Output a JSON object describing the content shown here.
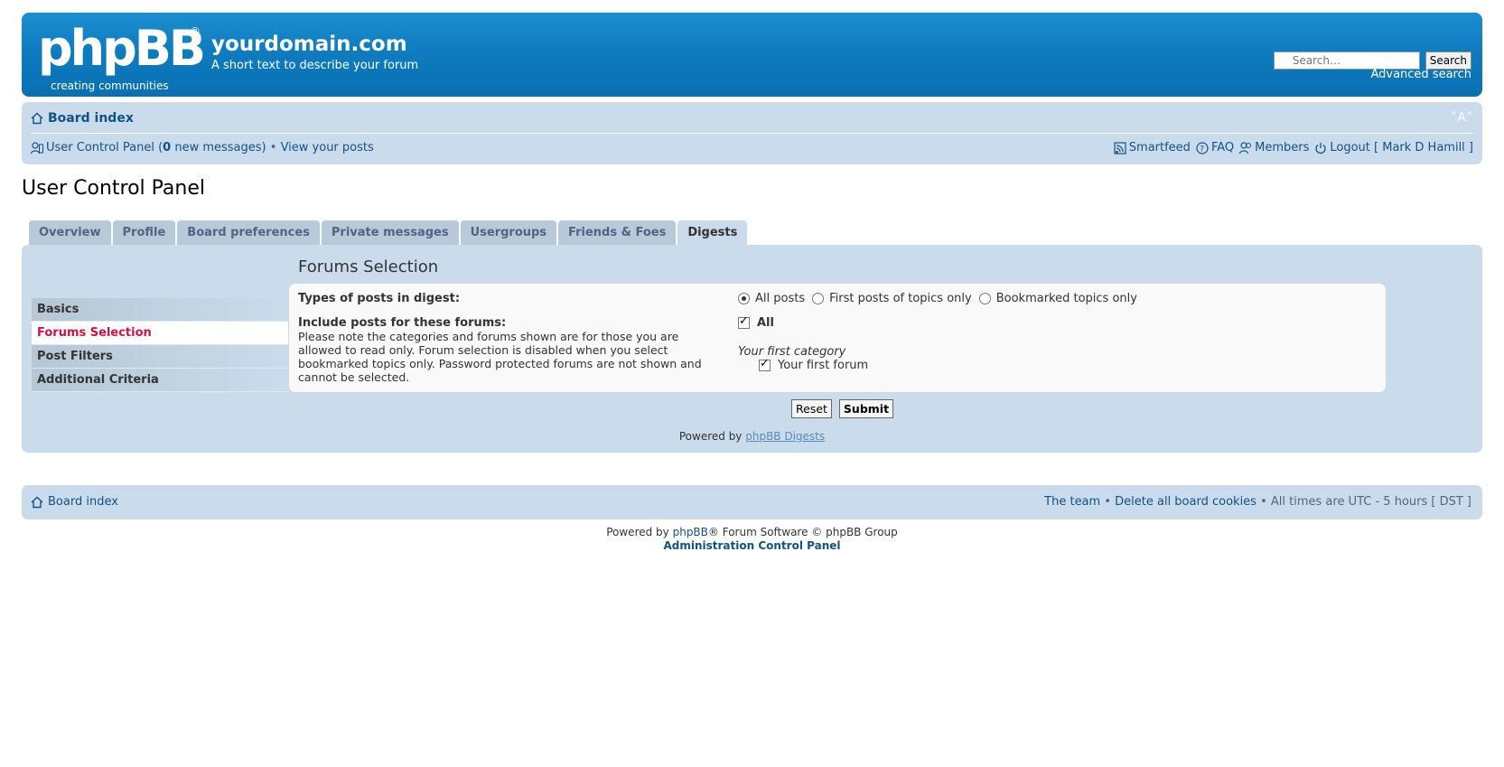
{
  "header": {
    "logo_text": "phpBB",
    "logo_reg": "®",
    "logo_tagline": "creating  communities",
    "site_name": "yourdomain.com",
    "site_desc": "A short text to describe your forum",
    "search_placeholder": "Search…",
    "search_button": "Search",
    "advanced_search": "Advanced search"
  },
  "navbar": {
    "board_index": "Board index",
    "font_size": "˅A˄",
    "ucp_link": "User Control Panel (",
    "new_count": "0",
    "new_messages_suffix": " new messages)",
    "bullet": " • ",
    "view_posts": "View your posts",
    "smartfeed": "Smartfeed",
    "faq": "FAQ",
    "members": "Members",
    "logout": "Logout [ Mark D Hamill ]"
  },
  "page_title": "User Control Panel",
  "tabs": [
    {
      "label": "Overview"
    },
    {
      "label": "Profile"
    },
    {
      "label": "Board preferences"
    },
    {
      "label": "Private messages"
    },
    {
      "label": "Usergroups"
    },
    {
      "label": "Friends & Foes"
    },
    {
      "label": "Digests"
    }
  ],
  "menu": [
    {
      "label": "Basics"
    },
    {
      "label": "Forums Selection"
    },
    {
      "label": "Post Filters"
    },
    {
      "label": "Additional Criteria"
    }
  ],
  "content": {
    "title": "Forums Selection",
    "types_label": "Types of posts in digest:",
    "radio_all": "All posts",
    "radio_first": "First posts of topics only",
    "radio_bookmarked": "Bookmarked topics only",
    "include_label": "Include posts for these forums:",
    "include_explain": "Please note the categories and forums shown are for those you are allowed to read only. Forum selection is disabled when you select bookmarked topics only. Password protected forums are not shown and cannot be selected.",
    "all_label": "All",
    "category": "Your first category",
    "forum": "Your first forum",
    "reset_button": "Reset",
    "submit_button": "Submit",
    "powered_prefix": "Powered by ",
    "powered_link": "phpBB Digests"
  },
  "footer": {
    "board_index": "Board index",
    "team": "The team",
    "bullet": " • ",
    "delete_cookies": "Delete all board cookies",
    "times": "All times are UTC - 5 hours [ DST ]",
    "powered_prefix": "Powered by ",
    "phpbb": "phpBB",
    "powered_suffix": "® Forum Software © phpBB Group",
    "acp": "Administration Control Panel"
  },
  "colors": {
    "header_blue": "#0f7cc0",
    "panel_bg": "#cadceb",
    "link": "#105289",
    "active_menu": "#d31141"
  }
}
